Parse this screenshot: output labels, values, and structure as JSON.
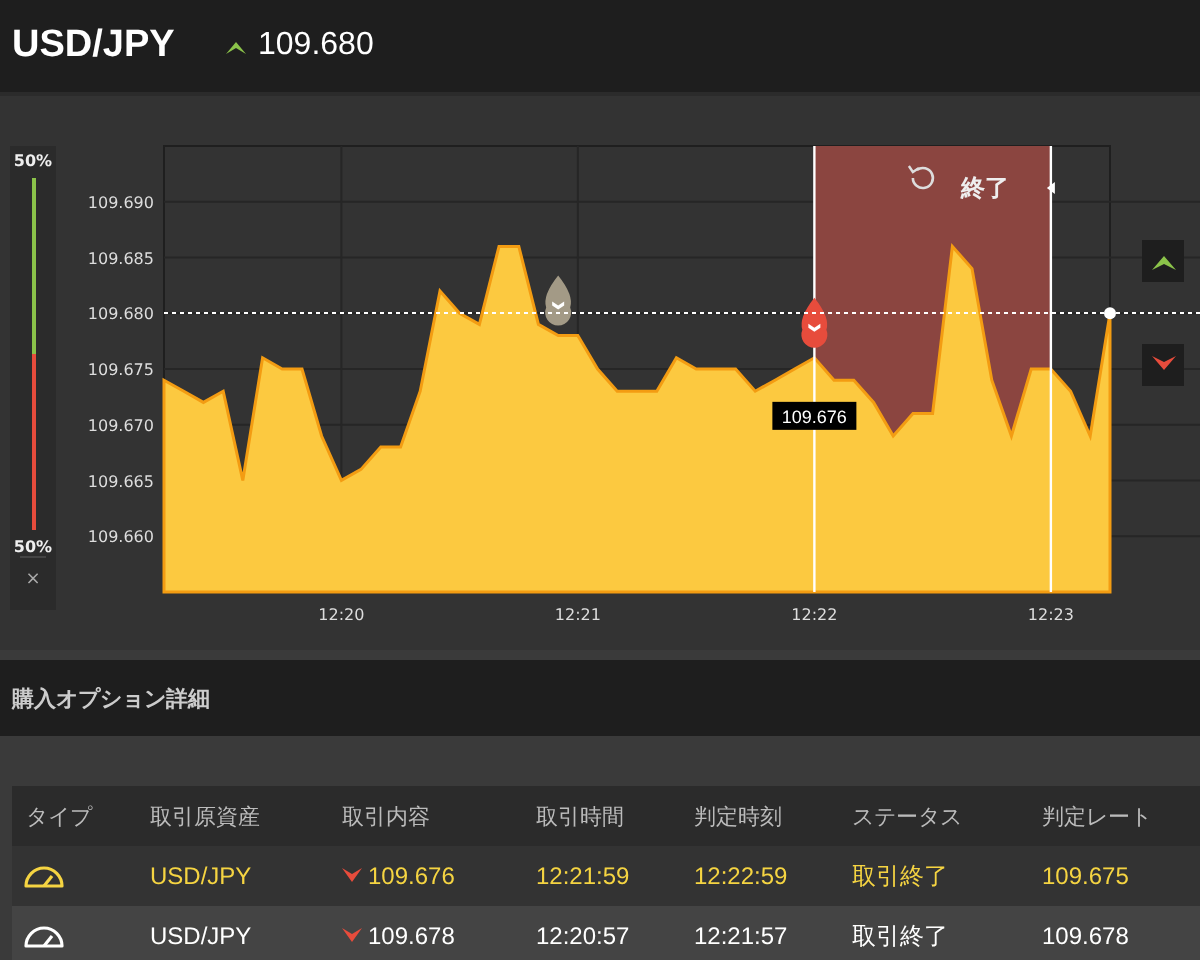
{
  "header": {
    "pair": "USD/JPY",
    "up": true,
    "price": "109.680"
  },
  "gauge": {
    "top_label": "50%",
    "bottom_label": "50%",
    "level": 0.5,
    "close": "×"
  },
  "chart": {
    "chart_data": {
      "type": "area",
      "categories": [
        null,
        null,
        null,
        null,
        null,
        null,
        null,
        null,
        null,
        "12:20",
        null,
        null,
        null,
        null,
        null,
        null,
        null,
        null,
        null,
        null,
        null,
        "12:21",
        null,
        null,
        null,
        null,
        null,
        null,
        null,
        null,
        null,
        null,
        null,
        "12:22",
        null,
        null,
        null,
        null,
        null,
        null,
        null,
        null,
        null,
        null,
        null,
        "12:23",
        null,
        null,
        null
      ],
      "series": [
        {
          "color": "#fcc940",
          "values": [
            109.674,
            109.673,
            109.672,
            109.673,
            109.665,
            109.676,
            109.675,
            109.675,
            109.669,
            109.665,
            109.666,
            109.668,
            109.668,
            109.673,
            109.682,
            109.68,
            109.679,
            109.686,
            109.686,
            109.679,
            109.678,
            109.678,
            109.675,
            109.673,
            109.673,
            109.673,
            109.676,
            109.675,
            109.675,
            109.675,
            109.673,
            109.674,
            109.675,
            109.676,
            109.674,
            109.674,
            109.672,
            109.669,
            109.671,
            109.671,
            109.686,
            109.684,
            109.674,
            109.669,
            109.675,
            109.675,
            109.673,
            109.669,
            109.68
          ]
        }
      ],
      "ylim": [
        109.655,
        109.695
      ],
      "yticks": [
        {
          "value": 109.69,
          "label": "109.690"
        },
        {
          "value": 109.685,
          "label": "109.685"
        },
        {
          "value": 109.68,
          "label": "109.680"
        },
        {
          "value": 109.675,
          "label": "109.675"
        },
        {
          "value": 109.67,
          "label": "109.670"
        },
        {
          "value": 109.665,
          "label": "109.665"
        },
        {
          "value": 109.66,
          "label": "109.660"
        }
      ],
      "grid": true
    },
    "expiry": {
      "label": "終了"
    },
    "markers": [
      {
        "kind": "past-entry"
      },
      {
        "kind": "entry",
        "label": "109.676"
      }
    ]
  },
  "trade_buttons": [
    {
      "kind": "up"
    },
    {
      "kind": "down"
    }
  ],
  "section_title": "購入オプション詳細",
  "table": {
    "columns": [
      "タイプ",
      "取引原資産",
      "取引内容",
      "取引時間",
      "判定時刻",
      "ステータス",
      "判定レート"
    ],
    "rows": [
      {
        "selected": true,
        "asset": "USD/JPY",
        "up": false,
        "entry": "109.676",
        "trade_time": "12:21:59",
        "expiry_time": "12:22:59",
        "status": "取引終了",
        "rate": "109.675"
      },
      {
        "selected": false,
        "asset": "USD/JPY",
        "up": false,
        "entry": "109.678",
        "trade_time": "12:20:57",
        "expiry_time": "12:21:57",
        "status": "取引終了",
        "rate": "109.678"
      }
    ]
  }
}
